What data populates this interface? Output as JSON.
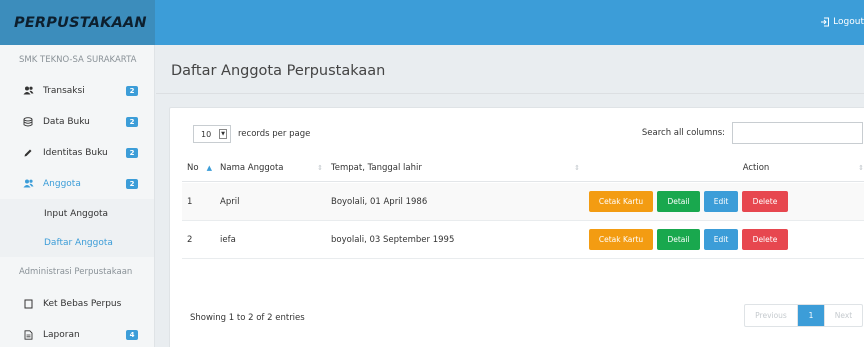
{
  "brand": "PERPUSTAKAAN",
  "topbar": {
    "logout_label": "Logout"
  },
  "sidebar": {
    "school": "SMK TEKNO-SA SURAKARTA",
    "items": [
      {
        "label": "Transaksi",
        "icon": "users-icon",
        "badge": "2"
      },
      {
        "label": "Data Buku",
        "icon": "database-icon",
        "badge": "2"
      },
      {
        "label": "Identitas Buku",
        "icon": "pencil-icon",
        "badge": "2"
      },
      {
        "label": "Anggota",
        "icon": "users-icon",
        "badge": "2"
      }
    ],
    "subitems": [
      {
        "label": "Input Anggota"
      },
      {
        "label": "Daftar Anggota"
      }
    ],
    "section_label": "Administrasi Perpustakaan",
    "admin_items": [
      {
        "label": "Ket Bebas Perpus",
        "icon": "square-icon"
      },
      {
        "label": "Laporan",
        "icon": "document-icon",
        "badge": "4"
      }
    ],
    "active_color": "#3c9dd8"
  },
  "main": {
    "title": "Daftar Anggota Perpustakaan",
    "length_value": "10",
    "length_label": "records per page",
    "search_label": "Search all columns:",
    "search_value": "",
    "columns": [
      "No",
      "Nama Anggota",
      "Tempat, Tanggal lahir",
      "Action"
    ],
    "rows": [
      {
        "no": "1",
        "nama": "April",
        "ttl": "Boyolali, 01 April 1986"
      },
      {
        "no": "2",
        "nama": "iefa",
        "ttl": "boyolali, 03 September 1995"
      }
    ],
    "actions": {
      "cetak": "Cetak Kartu",
      "detail": "Detail",
      "edit": "Edit",
      "delete": "Delete"
    },
    "info": "Showing 1 to 2 of 2 entries",
    "pager": {
      "prev": "Previous",
      "page": "1",
      "next": "Next"
    }
  },
  "colors": {
    "topbar": "#3c9dd8",
    "brand_bg": "#3c8dbc",
    "cetak": "#f39c12",
    "detail": "#19a84e",
    "edit": "#3c9dd8",
    "delete": "#e7474f"
  }
}
